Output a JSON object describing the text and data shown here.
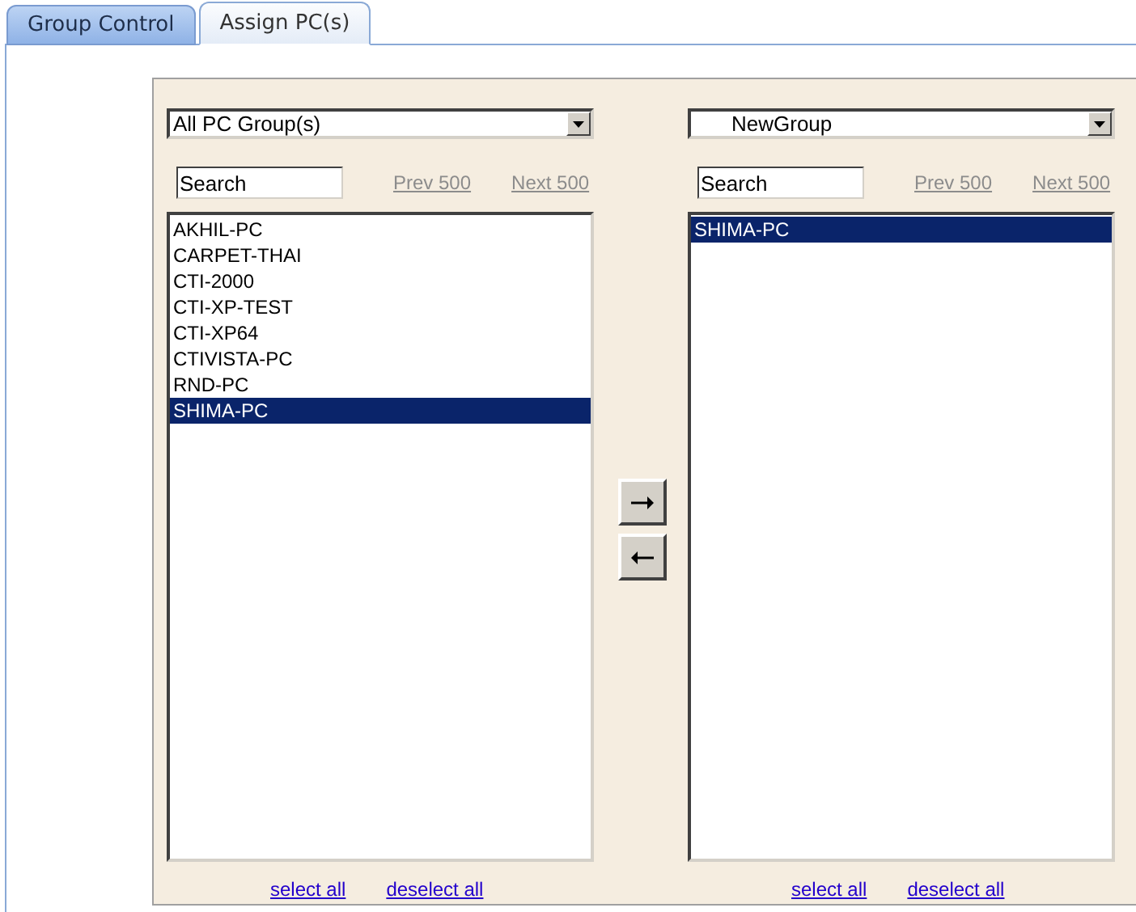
{
  "tabs": [
    {
      "label": "Group Control",
      "selected": false
    },
    {
      "label": "Assign PC(s)",
      "selected": true
    }
  ],
  "left": {
    "group_select": "All PC Group(s)",
    "search": {
      "value": "Search"
    },
    "prev": "Prev 500",
    "next": "Next 500",
    "items": [
      {
        "label": "AKHIL-PC",
        "selected": false
      },
      {
        "label": "CARPET-THAI",
        "selected": false
      },
      {
        "label": "CTI-2000",
        "selected": false
      },
      {
        "label": "CTI-XP-TEST",
        "selected": false
      },
      {
        "label": "CTI-XP64",
        "selected": false
      },
      {
        "label": "CTIVISTA-PC",
        "selected": false
      },
      {
        "label": "RND-PC",
        "selected": false
      },
      {
        "label": "SHIMA-PC",
        "selected": true
      }
    ],
    "select_all": "select all",
    "deselect_all": "deselect all"
  },
  "right": {
    "group_select": "NewGroup",
    "search": {
      "value": "Search"
    },
    "prev": "Prev 500",
    "next": "Next 500",
    "items": [
      {
        "label": "SHIMA-PC",
        "selected": true
      }
    ],
    "select_all": "select all",
    "deselect_all": "deselect all"
  }
}
